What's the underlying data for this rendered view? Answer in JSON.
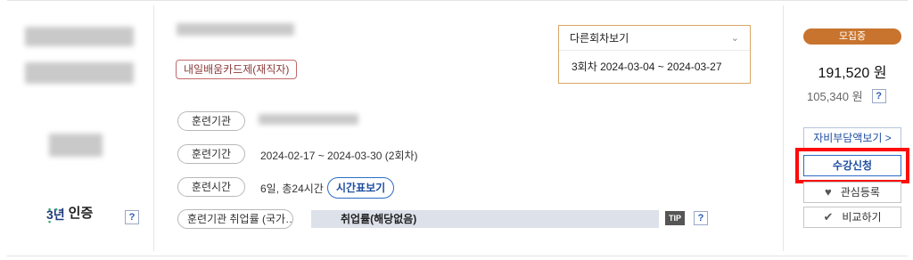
{
  "course": {
    "card_type_badge": "내일배움카드제(재직자)",
    "certification": {
      "years": "3년",
      "label": "인증"
    },
    "rows": {
      "institution_label": "훈련기관",
      "period_label": "훈련기간",
      "period_value": "2024-02-17 ~ 2024-03-30 (2회차)",
      "hours_label": "훈련시간",
      "hours_value": "6일, 총24시간",
      "timetable_button": "시간표보기",
      "employment_label": "훈련기관 취업률 (국가…",
      "employment_value": "취업률(해당없음)",
      "tip_label": "TIP"
    }
  },
  "session_dropdown": {
    "title": "다른회차보기",
    "selected": "3회차 2024-03-04 ~ 2024-03-27"
  },
  "pricing": {
    "status_badge": "모집중",
    "price": "191,520 원",
    "self_pay": "105,340 원"
  },
  "actions": {
    "self_pay_view": "자비부담액보기 >",
    "apply": "수강신청",
    "wishlist": "관심등록",
    "compare": "비교하기"
  },
  "help_mark": "?",
  "colors": {
    "status_orange": "#c8742e",
    "link_blue": "#1f4ea0",
    "highlight_red": "#ff0a0a",
    "dropdown_border": "#d9a766"
  }
}
